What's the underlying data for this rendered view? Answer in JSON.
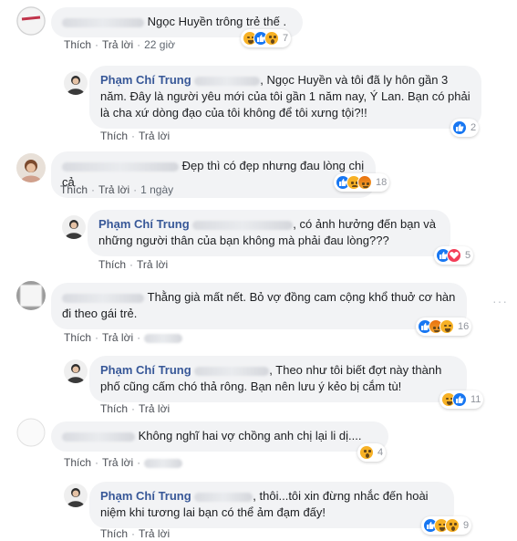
{
  "labels": {
    "like": "Thích",
    "reply": "Trả lời"
  },
  "comments": [
    {
      "name": "Lê Trần Hoa",
      "text": "Ngọc Huyền trông trẻ thế .",
      "time": "22 giờ",
      "reaction_count": "7",
      "reactions": [
        "haha-icon",
        "like-icon",
        "wow-icon"
      ],
      "reply": {
        "name": "Phạm Chí Trung",
        "mention": "Lê Trần Hoa",
        "text": ", Ngọc Huyền và tôi đã ly hôn gần 3 năm. Đây là người yêu mới của tôi gần 1 năm nay, Ý Lan. Bạn có phải là cha xứ dòng đạo của tôi không để tôi xưng tội?!!",
        "reaction_count": "2",
        "reactions": [
          "like-icon"
        ]
      }
    },
    {
      "name": "",
      "text": "Đẹp thì có đẹp nhưng đau lòng chị cả",
      "time": "1 ngày",
      "reaction_count": "18",
      "reactions": [
        "like-icon",
        "sad-icon",
        "angry-icon"
      ],
      "reply": {
        "name": "Phạm Chí Trung",
        "mention": "",
        "text": ", có ảnh hưởng đến bạn và những người thân của bạn không mà phải đau lòng???",
        "reaction_count": "5",
        "reactions": [
          "like-icon",
          "love-icon"
        ]
      }
    },
    {
      "name": "",
      "text": "Thằng già mất nết. Bỏ vợ đồng cam cộng khổ thuở cơ hàn đi theo gái trẻ.",
      "time": "",
      "reaction_count": "16",
      "reactions": [
        "like-icon",
        "angry-icon",
        "haha-icon"
      ],
      "reply": {
        "name": "Phạm Chí Trung",
        "mention": "",
        "text": ", Theo như tôi biết đợt này thành phố cũng cấm chó thả rông. Bạn nên lưu ý kẻo bị cắm tù!",
        "reaction_count": "11",
        "reactions": [
          "haha-icon",
          "like-icon"
        ]
      }
    },
    {
      "name": "",
      "text": "Không nghĩ hai vợ chồng anh chị lại li dị....",
      "time": "",
      "reaction_count": "4",
      "reactions": [
        "wow-icon"
      ],
      "reply": {
        "name": "Phạm Chí Trung",
        "mention": "",
        "text": ", thôi...tôi xin đừng nhắc đến hoài niệm khi tương lai bạn có thể ảm đạm đấy!",
        "reaction_count": "9",
        "reactions": [
          "like-icon",
          "haha-icon",
          "wow-icon"
        ]
      }
    }
  ]
}
